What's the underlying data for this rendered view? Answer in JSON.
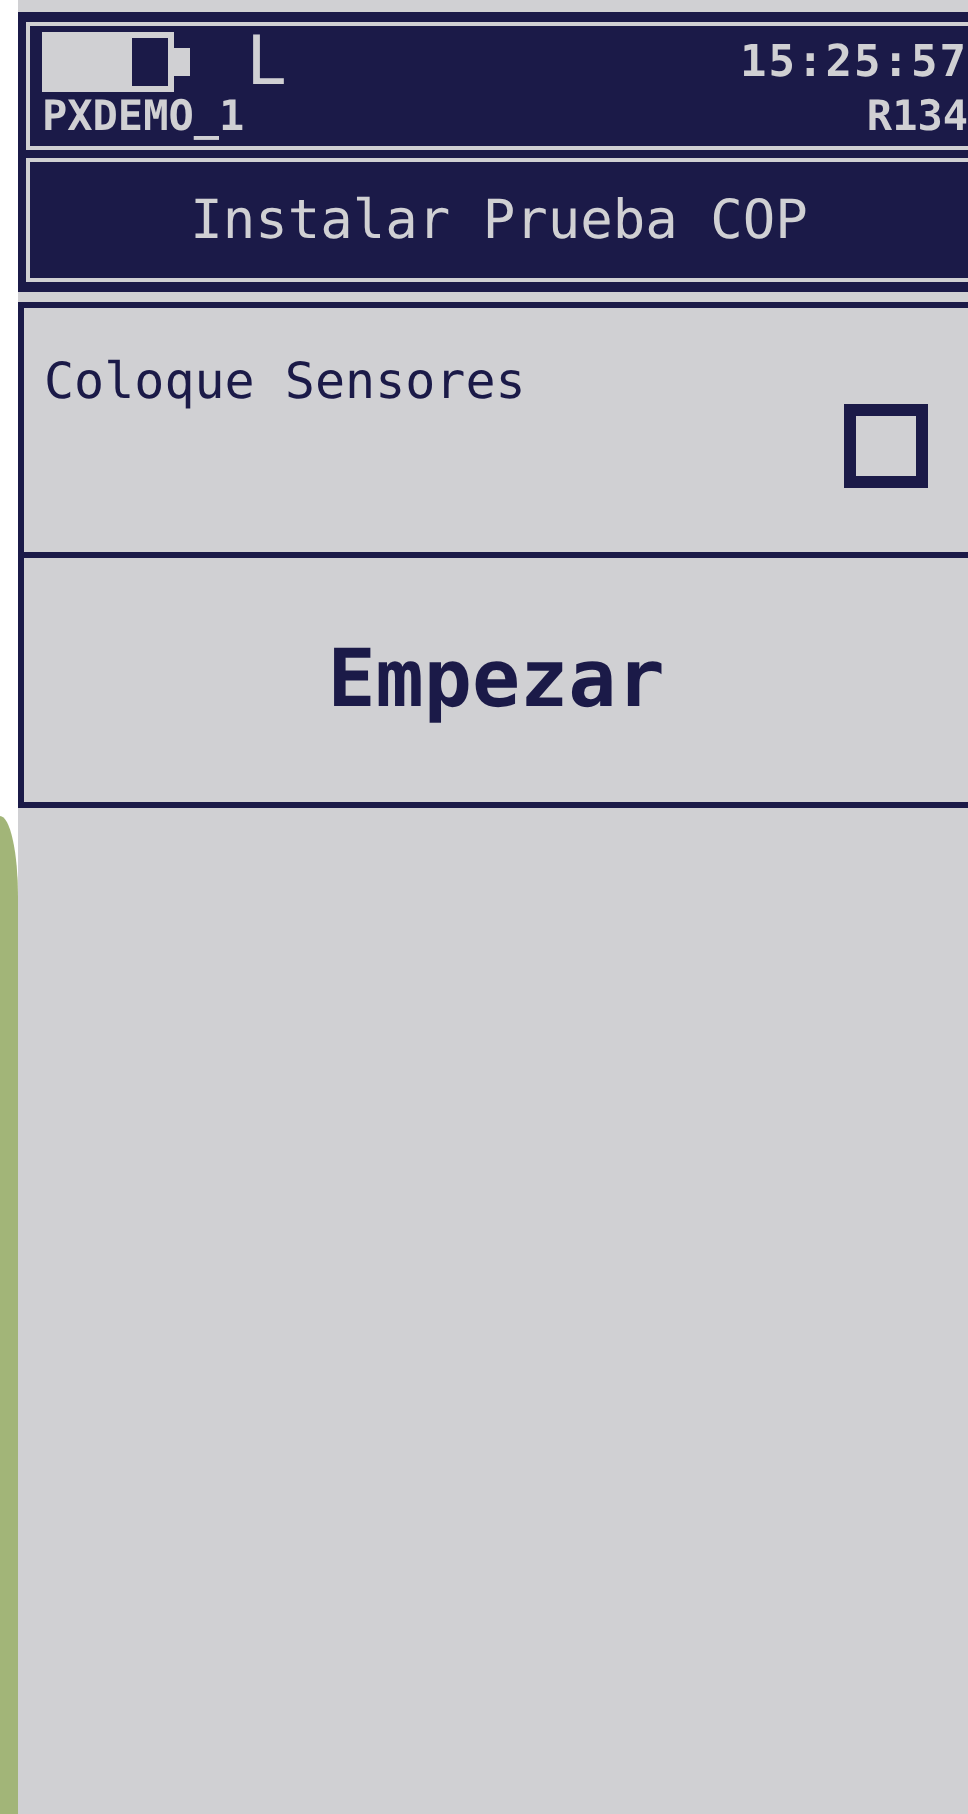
{
  "status_bar": {
    "level": 0.7,
    "mode": "L",
    "time": "15:25:57",
    "device": "PXDEMO_1",
    "refrigerant": "R134"
  },
  "title": "Instalar Prueba COP",
  "items": [
    {
      "kind": "checkbox",
      "label": "Coloque Sensores",
      "checked": false
    },
    {
      "kind": "button",
      "label": "Empezar"
    }
  ]
}
